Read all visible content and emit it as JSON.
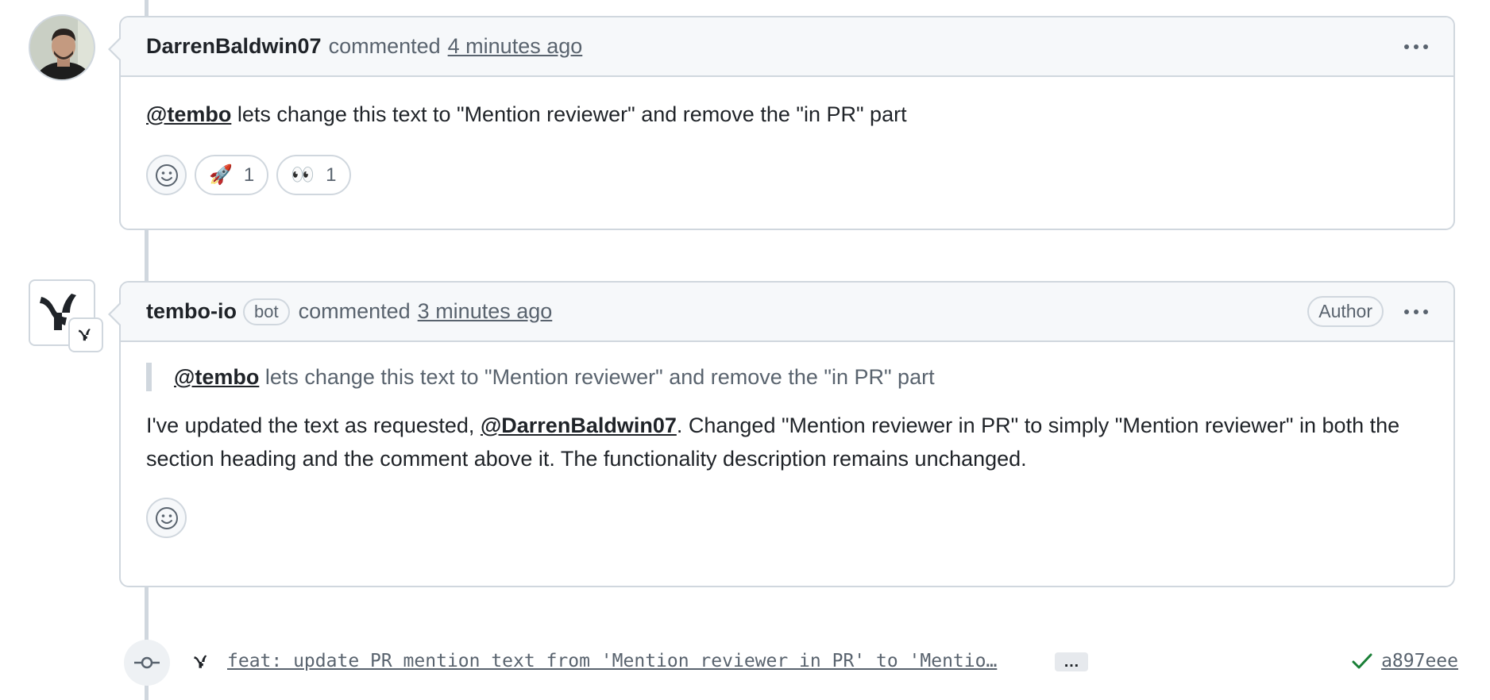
{
  "comments": [
    {
      "author": "DarrenBaldwin07",
      "verb": "commented",
      "time": "4 minutes ago",
      "body": {
        "mention": "@tembo",
        "text": " lets change this text to \"Mention reviewer\" and remove the \"in PR\" part"
      },
      "reactions": [
        {
          "emoji": "🚀",
          "count": "1"
        },
        {
          "emoji": "👀",
          "count": "1"
        }
      ]
    },
    {
      "author": "tembo-io",
      "badge": "bot",
      "verb": "commented",
      "time": "3 minutes ago",
      "author_label": "Author",
      "quote": {
        "mention": "@tembo",
        "text": " lets change this text to \"Mention reviewer\" and remove the \"in PR\" part"
      },
      "body": {
        "prefix": "I've updated the text as requested, ",
        "mention": "@DarrenBaldwin07",
        "suffix": ". Changed \"Mention reviewer in PR\" to simply \"Mention reviewer\" in both the section heading and the comment above it. The functionality description remains unchanged."
      }
    }
  ],
  "commit": {
    "message": "feat: update PR mention text from 'Mention reviewer in PR' to 'Mentio…",
    "expand_label": "…",
    "sha": "a897eee",
    "status": "success"
  },
  "colors": {
    "border": "#d0d7de",
    "header_bg": "#f6f8fa",
    "muted_text": "#59636e",
    "success": "#1a7f37"
  }
}
